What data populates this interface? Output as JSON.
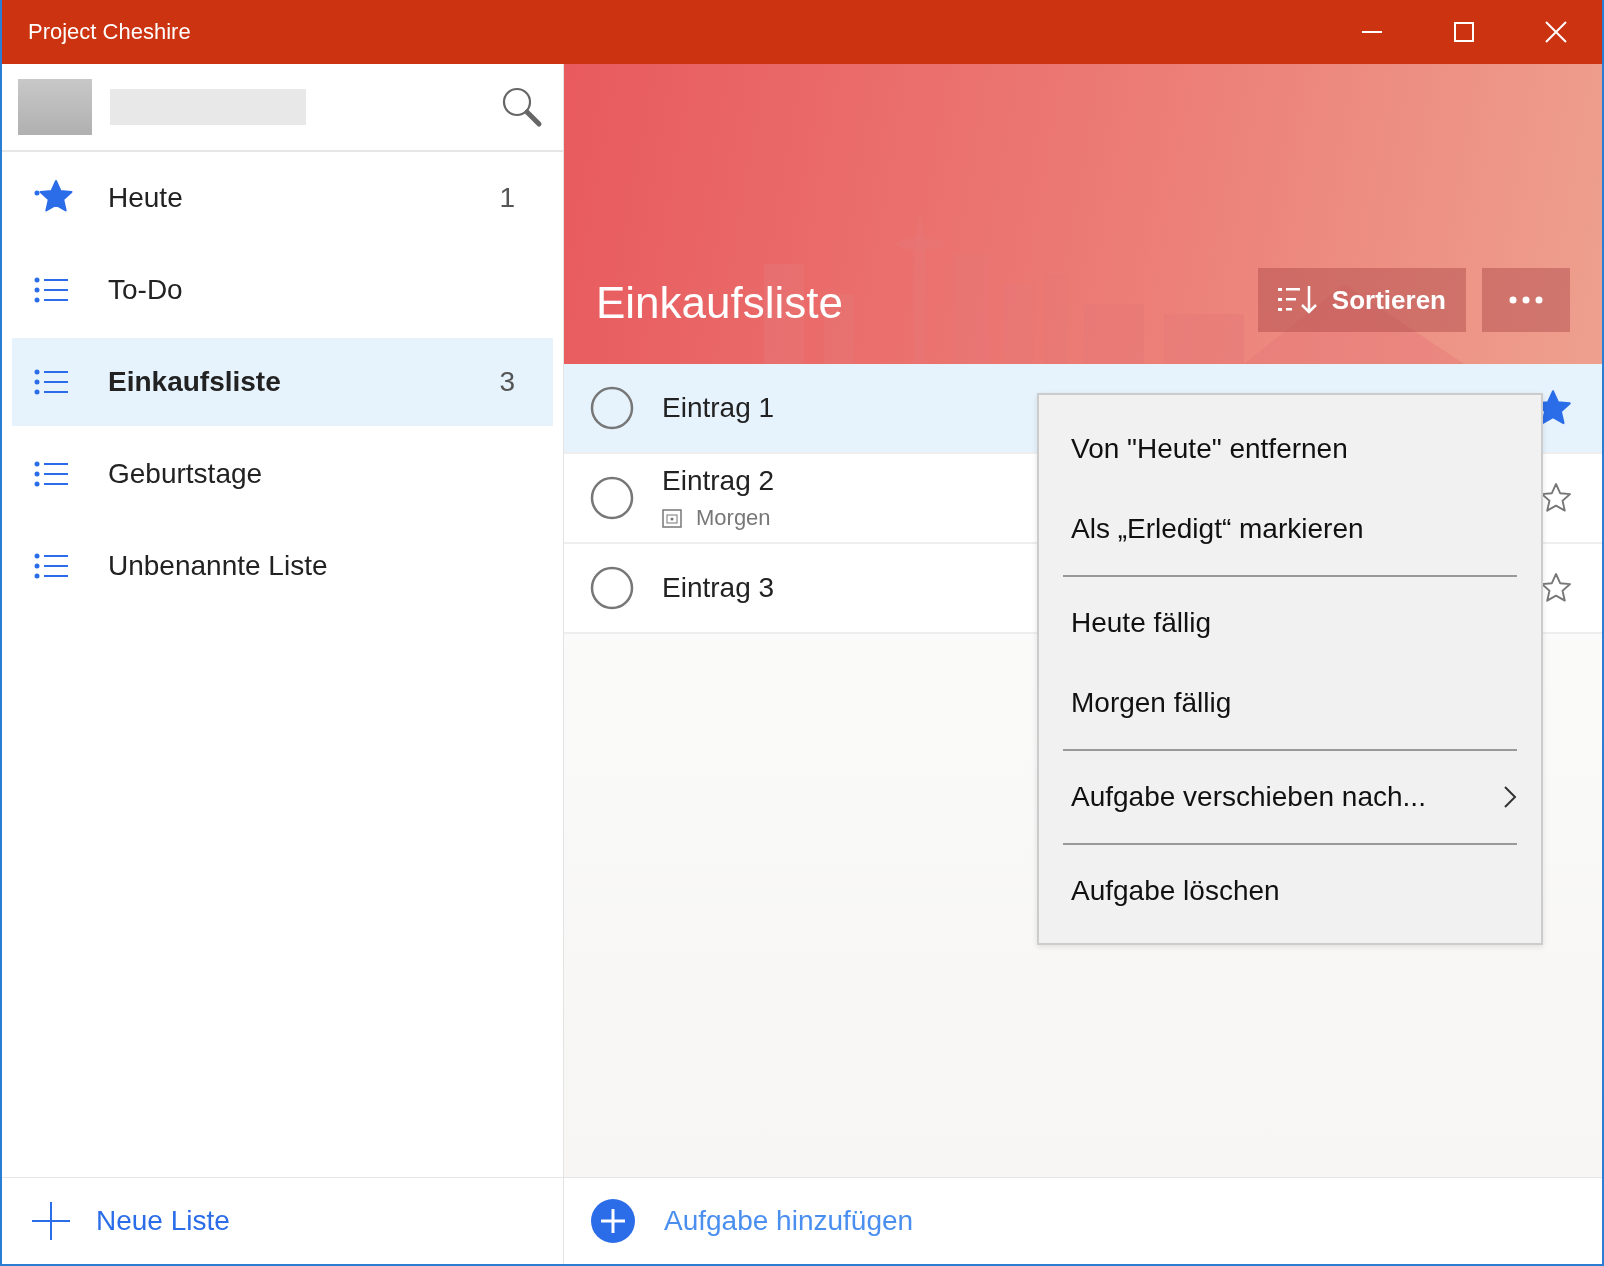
{
  "window": {
    "title": "Project Cheshire"
  },
  "sidebar": {
    "items": [
      {
        "label": "Heute",
        "kind": "star",
        "count": "1",
        "selected": false
      },
      {
        "label": "To-Do",
        "kind": "list",
        "selected": false
      },
      {
        "label": "Einkaufsliste",
        "kind": "list",
        "count": "3",
        "selected": true
      },
      {
        "label": "Geburtstage",
        "kind": "list",
        "selected": false
      },
      {
        "label": "Unbenannte Liste",
        "kind": "list",
        "selected": false
      }
    ],
    "new_list": "Neue Liste"
  },
  "list": {
    "title": "Einkaufsliste",
    "sort_button": "Sortieren",
    "tasks": [
      {
        "title": "Eintrag 1",
        "completed": false,
        "starred": true,
        "selected": true
      },
      {
        "title": "Eintrag 2",
        "due": "Morgen",
        "completed": false,
        "starred": false,
        "selected": false
      },
      {
        "title": "Eintrag 3",
        "completed": false,
        "starred": false,
        "selected": false
      }
    ],
    "add_task": "Aufgabe hinzufügen"
  },
  "context_menu": {
    "groups": [
      [
        {
          "label": "Von \"Heute\" entfernen"
        },
        {
          "label": "Als „Erledigt“ markieren"
        }
      ],
      [
        {
          "label": "Heute fällig"
        },
        {
          "label": "Morgen fällig"
        }
      ],
      [
        {
          "label": "Aufgabe verschieben nach...",
          "submenu": true
        }
      ],
      [
        {
          "label": "Aufgabe löschen"
        }
      ]
    ]
  }
}
